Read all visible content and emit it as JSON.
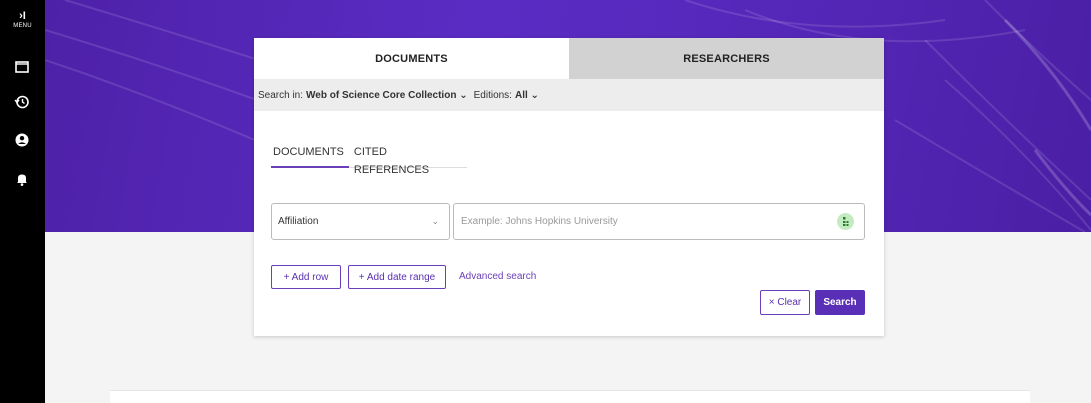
{
  "sidebar": {
    "menu_chevron": "›I",
    "menu_label": "MENU",
    "icons": [
      "folder-icon",
      "history-icon",
      "account-icon",
      "bell-icon"
    ]
  },
  "tabs": {
    "documents": "DOCUMENTS",
    "researchers": "RESEARCHERS",
    "active": "DOCUMENTS"
  },
  "scope": {
    "search_in_label": "Search in:",
    "collection": "Web of Science Core Collection",
    "editions_label": "Editions:",
    "editions_value": "All"
  },
  "sub_tabs": {
    "documents": "DOCUMENTS",
    "cited_references": "CITED REFERENCES",
    "active": "DOCUMENTS"
  },
  "search_row": {
    "field": "Affiliation",
    "placeholder": "Example: Johns Hopkins University",
    "value": ""
  },
  "actions": {
    "add_row": "+ Add row",
    "add_date_range": "+ Add date range",
    "advanced_search": "Advanced search",
    "clear": "× Clear",
    "search": "Search"
  },
  "colors": {
    "sidebar": "#000000",
    "hero_purple": "#5b2cc4",
    "accent": "#6a3fb8",
    "search_button": "#5a2fb8"
  }
}
